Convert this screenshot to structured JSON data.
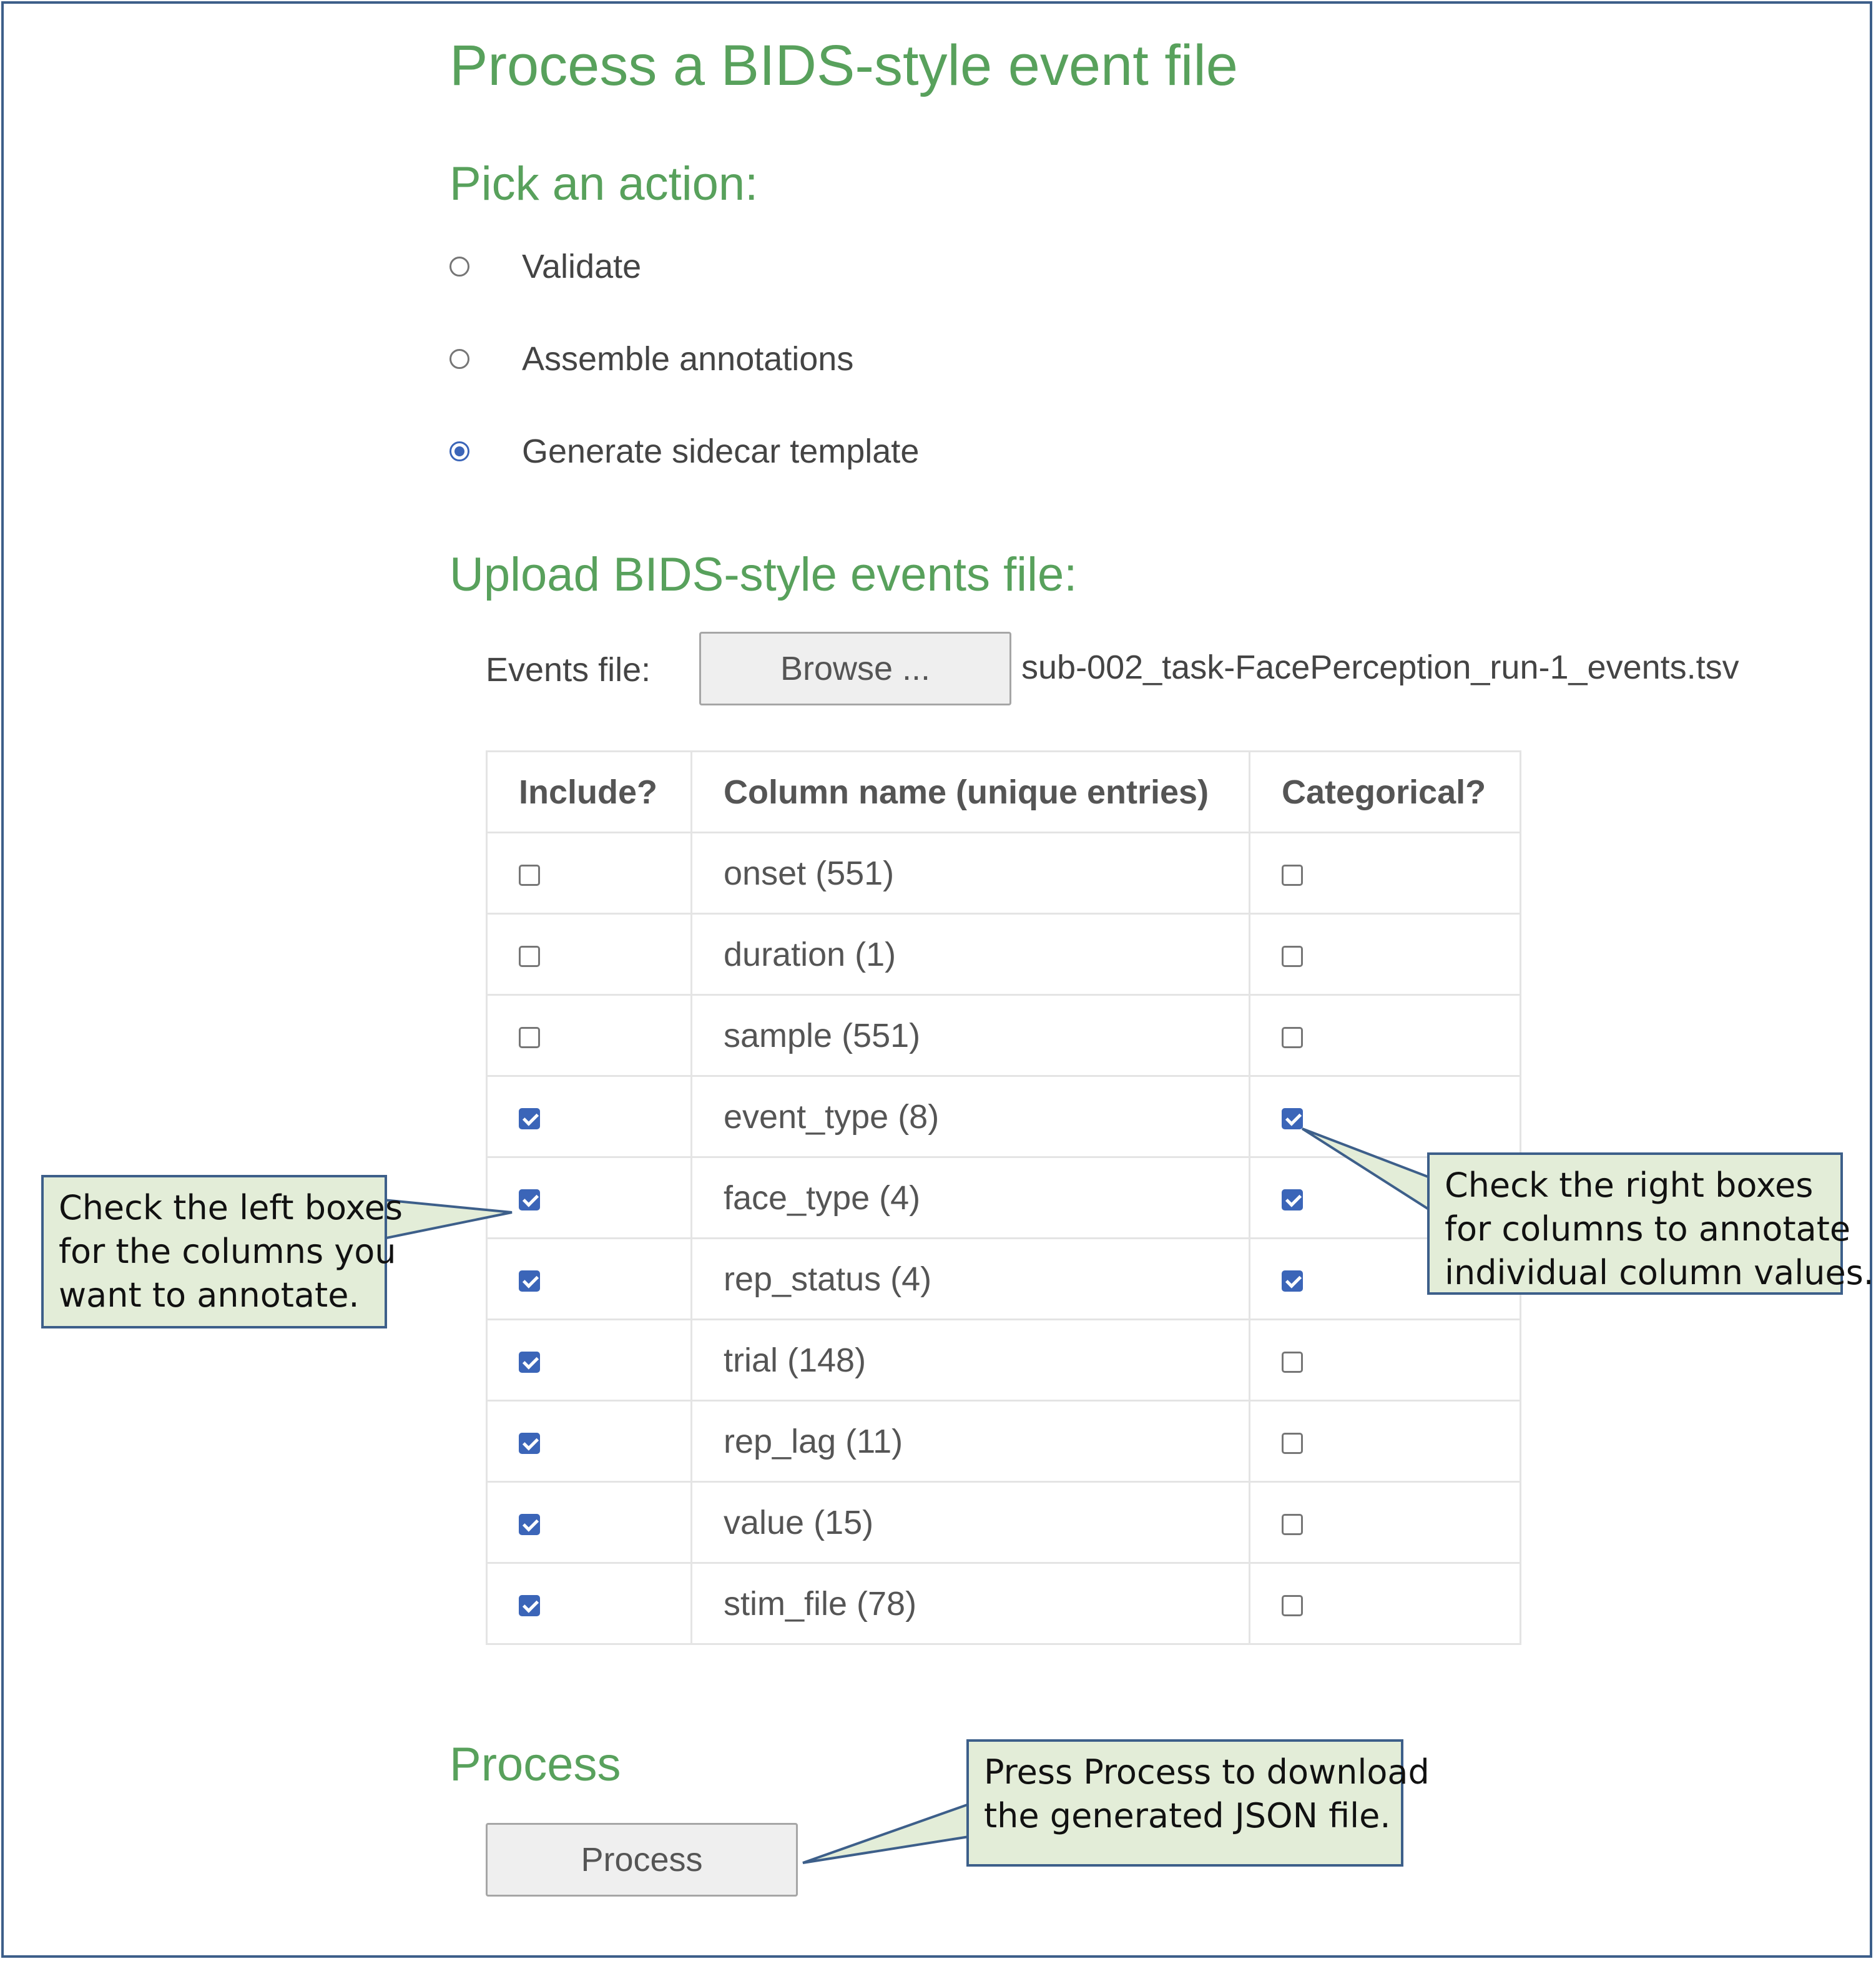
{
  "page": {
    "title": "Process a BIDS-style event file",
    "action_heading": "Pick an action:",
    "upload_heading": "Upload BIDS-style events file:",
    "process_heading": "Process"
  },
  "actions": [
    {
      "label": "Validate",
      "selected": false
    },
    {
      "label": "Assemble annotations",
      "selected": false
    },
    {
      "label": "Generate sidecar template",
      "selected": true
    }
  ],
  "upload": {
    "field_label": "Events file:",
    "browse_label": "Browse ...",
    "file_name": "sub-002_task-FacePerception_run-1_events.tsv"
  },
  "table": {
    "headers": [
      "Include?",
      "Column name (unique entries)",
      "Categorical?"
    ],
    "rows": [
      {
        "name": "onset (551)",
        "include": false,
        "categorical": false
      },
      {
        "name": "duration (1)",
        "include": false,
        "categorical": false
      },
      {
        "name": "sample (551)",
        "include": false,
        "categorical": false
      },
      {
        "name": "event_type (8)",
        "include": true,
        "categorical": true
      },
      {
        "name": "face_type (4)",
        "include": true,
        "categorical": true
      },
      {
        "name": "rep_status (4)",
        "include": true,
        "categorical": true
      },
      {
        "name": "trial (148)",
        "include": true,
        "categorical": false
      },
      {
        "name": "rep_lag (11)",
        "include": true,
        "categorical": false
      },
      {
        "name": "value (15)",
        "include": true,
        "categorical": false
      },
      {
        "name": "stim_file (78)",
        "include": true,
        "categorical": false
      }
    ]
  },
  "process": {
    "button_label": "Process"
  },
  "callouts": {
    "left": [
      "Check the left boxes",
      "for the columns you",
      "want to annotate."
    ],
    "right": [
      "Check the right boxes",
      "for columns to annotate",
      "individual column values."
    ],
    "bottom": [
      "Press Process to download",
      "the generated JSON file."
    ]
  },
  "colors": {
    "heading": "#58a15c",
    "checked": "#3b65b8",
    "callout_fill": "#e3edd8",
    "callout_border": "#3d5f8a"
  }
}
